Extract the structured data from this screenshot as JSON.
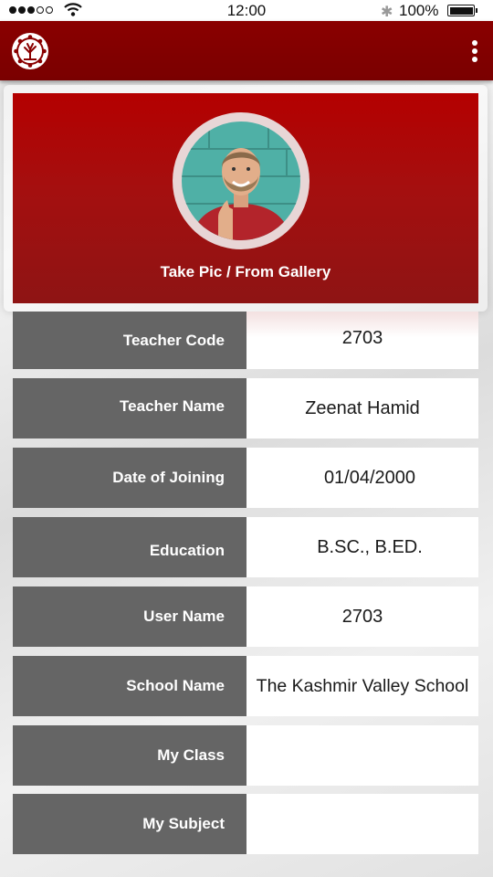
{
  "status_bar": {
    "time": "12:00",
    "battery": "100%"
  },
  "colors": {
    "app_bar": "#7a0000",
    "card_top": "#b40000",
    "label_bg": "#656565"
  },
  "app_bar": {
    "logo_icon": "tree-logo-icon",
    "menu_icon": "more-vert-icon"
  },
  "profile": {
    "photo_action": "Take Pic / From Gallery"
  },
  "fields": [
    {
      "label": "Teacher Code",
      "value": "2703"
    },
    {
      "label": "Teacher Name",
      "value": "Zeenat Hamid"
    },
    {
      "label": "Date of Joining",
      "value": "01/04/2000"
    },
    {
      "label": "Education",
      "value": "B.SC., B.ED."
    },
    {
      "label": "User Name",
      "value": "2703"
    },
    {
      "label": "School Name",
      "value": "The Kashmir Valley School"
    },
    {
      "label": "My Class",
      "value": ""
    },
    {
      "label": "My Subject",
      "value": ""
    }
  ]
}
